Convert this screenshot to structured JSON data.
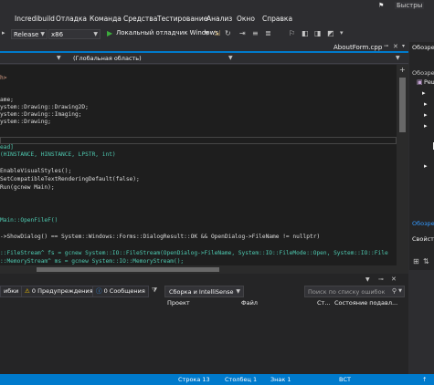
{
  "titlebar": {
    "quick_launch": "Быстры"
  },
  "menu": [
    "Incredibuild",
    "Отладка",
    "Команда",
    "Средства",
    "Тестирование",
    "Анализ",
    "Окно",
    "Справка"
  ],
  "toolbar": {
    "configuration": "Release",
    "platform": "x86",
    "debugger_label": "Локальный отладчик Windows"
  },
  "tabs": {
    "active_file": "AboutForm.cpp"
  },
  "navbar": {
    "scope": "(Глобальная область)"
  },
  "code_lines": [
    "h>",
    "ame;",
    "ystem::Drawing::Drawing2D;",
    "ystem::Drawing::Imaging;",
    "ystem::Drawing;",
    "ead]",
    "(HINSTANCE, HINSTANCE, LPSTR, int)",
    "EnableVisualStyles();",
    "SetCompatibleTextRenderingDefault(false);",
    "Run(gcnew Main);",
    "Main::OpenFileF()",
    "->ShowDialog() == System::Windows::Forms::DialogResult::OK && OpenDialog->FileName != nullptr)",
    "::FileStream^ fs = gcnew System::IO::FileStream(OpenDialog->FileName, System::IO::FileMode::Open, System::IO::File",
    "::MemoryStream^ ms = gcnew System::IO::MemoryStream();"
  ],
  "error_list": {
    "errors_suffix": "ибки",
    "warnings": "0 Предупреждения",
    "messages": "0 Сообщения",
    "filter": "Сборка и IntelliSense",
    "search_placeholder": "Поиск по списку ошибок",
    "columns": [
      "Проект",
      "Файл",
      "Ст...",
      "Состояние подавл..."
    ]
  },
  "rightpanel": {
    "explorer_title": "Обозре",
    "explorer_label": "Обозре",
    "item": "Реш",
    "explorer_bottom": "Обозре",
    "properties": "Свойств"
  },
  "status": {
    "line": "Строка 13",
    "column": "Столбец 1",
    "char": "Знак 1",
    "mode": "ВСТ"
  },
  "colors": {
    "accent": "#007acc",
    "editor_bg": "#1e1e1e",
    "chrome_bg": "#2d2d30",
    "keyword": "#569cd6",
    "type": "#4ec9b0"
  }
}
